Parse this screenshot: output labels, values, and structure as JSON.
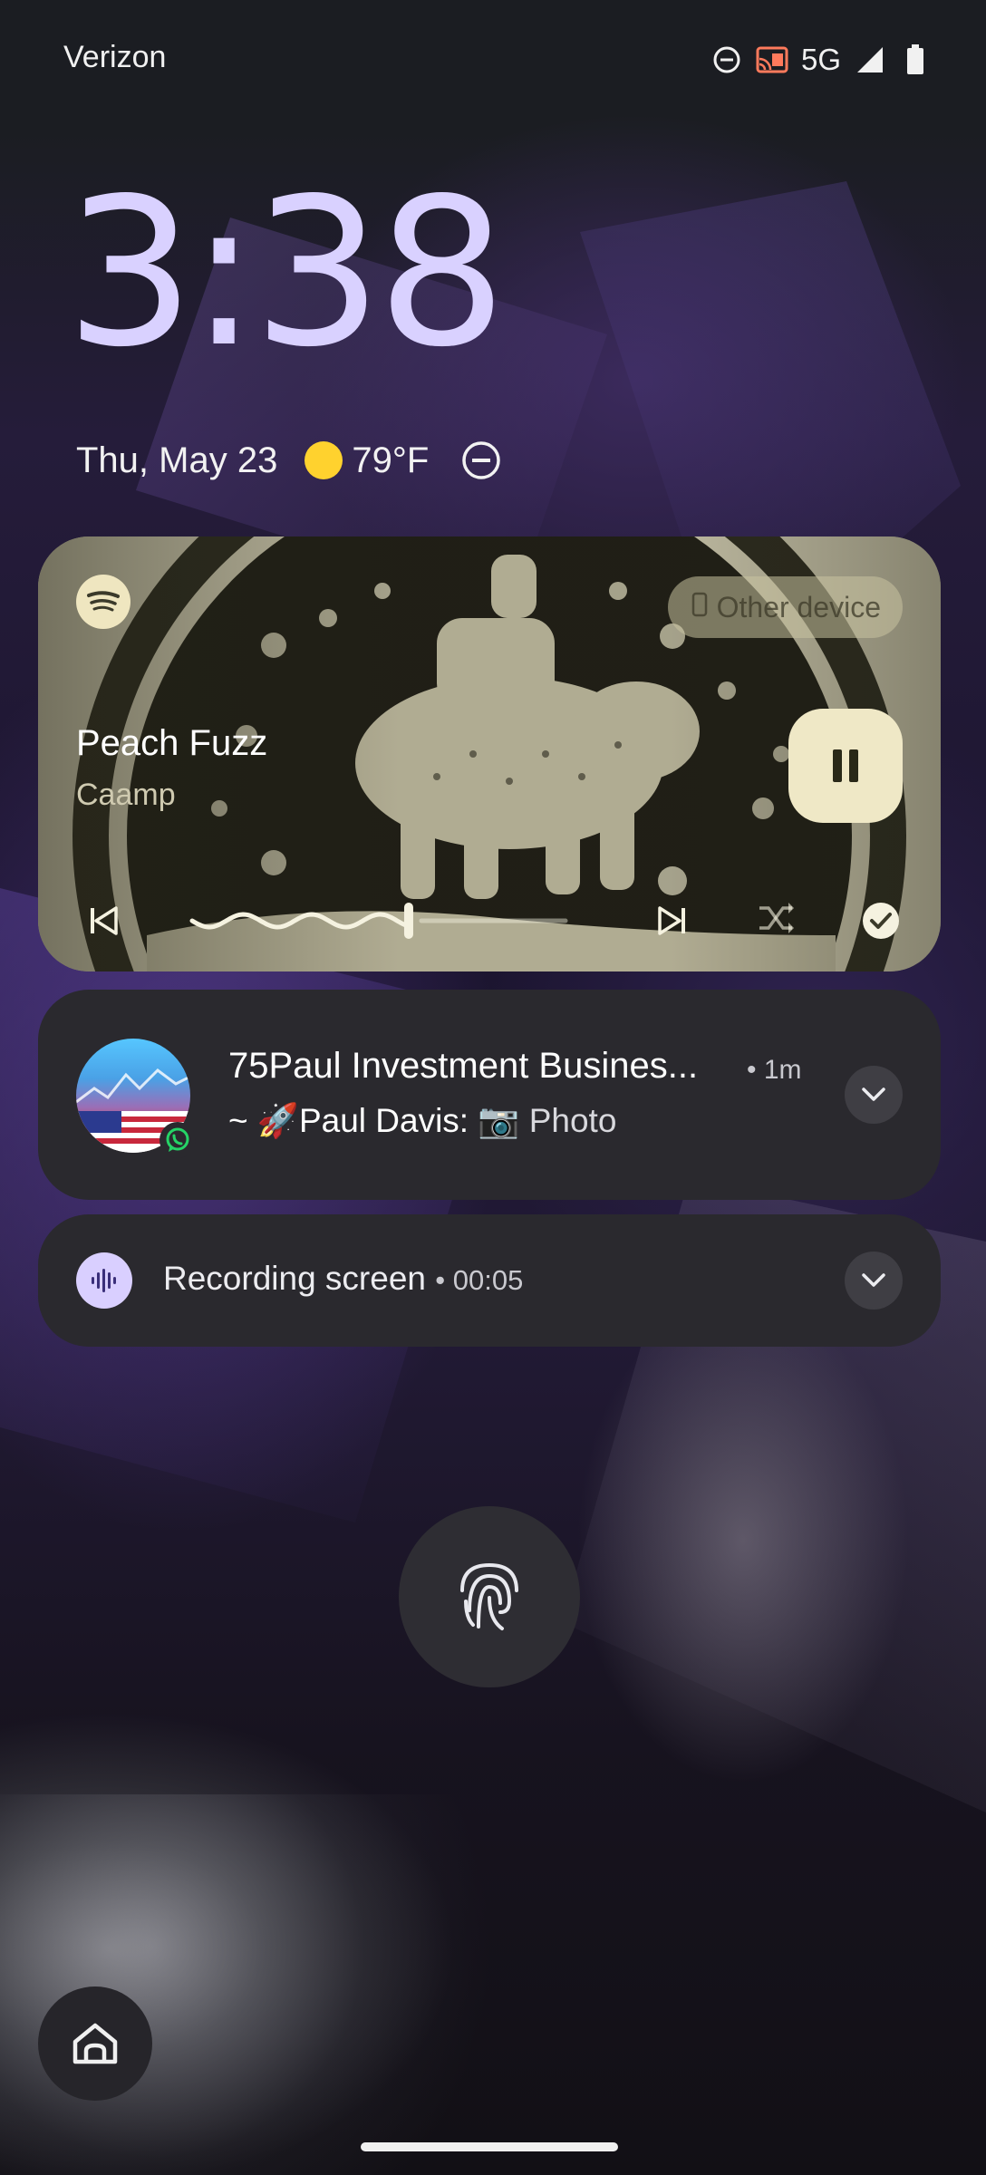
{
  "status_bar": {
    "carrier": "Verizon",
    "network": "5G",
    "icons": [
      "do-not-disturb-icon",
      "cast-icon",
      "signal-icon",
      "battery-icon"
    ]
  },
  "lockscreen": {
    "time": "3:38",
    "date": "Thu, May 23",
    "weather": {
      "icon": "sun-icon",
      "temperature": "79°F"
    },
    "dnd_icon": "do-not-disturb-icon"
  },
  "media": {
    "app": "Spotify",
    "output_device": "Other device",
    "track_title": "Peach Fuzz",
    "artist": "Caamp",
    "state": "playing",
    "progress": 0.58,
    "controls": [
      "previous-icon",
      "pause-icon",
      "next-icon",
      "shuffle-icon",
      "check-icon"
    ],
    "accent": "#efe8c6"
  },
  "notifications": [
    {
      "app": "WhatsApp",
      "title": "75Paul Investment Busines...",
      "time": "1m",
      "sender": "~ 🚀Paul Davis:",
      "message": "📷 Photo"
    },
    {
      "title": "Recording screen",
      "elapsed": "00:05"
    }
  ],
  "colors": {
    "clock": "#d9d1ff",
    "card_bg": "#2a292e",
    "sun": "#ffd22e",
    "whatsapp": "#25d366"
  }
}
